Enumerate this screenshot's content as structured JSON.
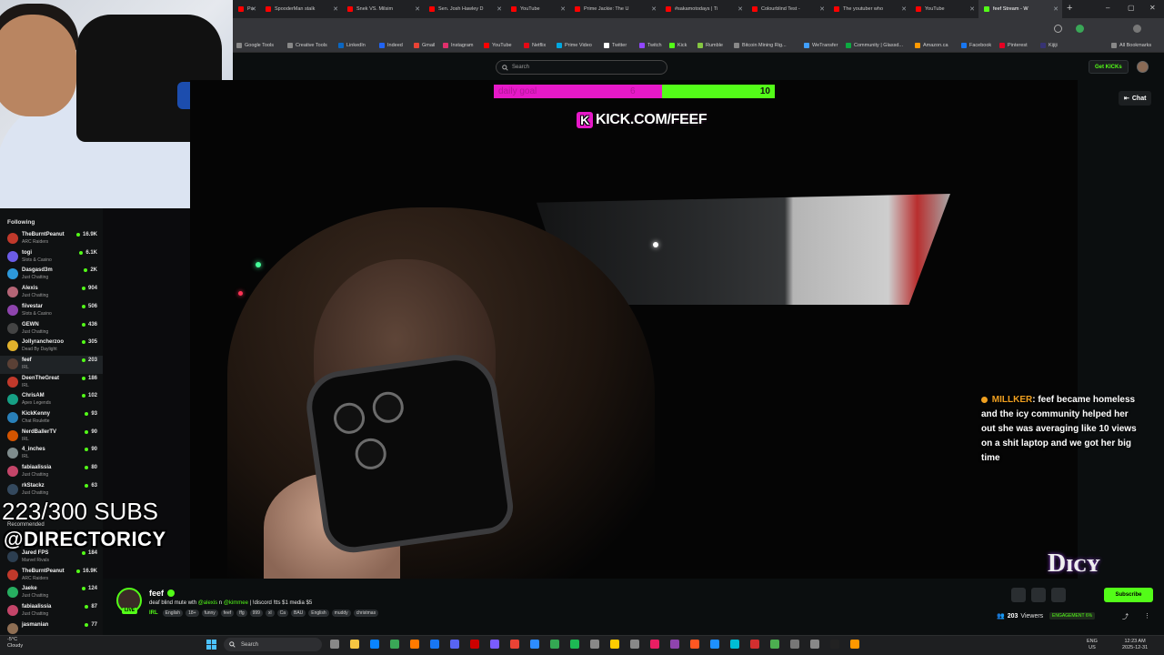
{
  "browser": {
    "tabs": [
      {
        "label": "Pa",
        "active": false
      },
      {
        "label": "SpooderMan stalk",
        "active": false
      },
      {
        "label": "Snek VS. Milsim",
        "active": false
      },
      {
        "label": "Sen. Josh Hawley D",
        "active": false
      },
      {
        "label": "YouTube",
        "active": false
      },
      {
        "label": "Prime Jackie: The U",
        "active": false
      },
      {
        "label": "#sakamotodays | Ti",
        "active": false
      },
      {
        "label": "Colourblind Test -",
        "active": false
      },
      {
        "label": "The youtuber who",
        "active": false
      },
      {
        "label": "YouTube",
        "active": false
      },
      {
        "label": "feef Stream - W",
        "active": true
      }
    ],
    "bookmarks": [
      "Google Tools",
      "Creative Tools",
      "LinkedIn",
      "Indeed",
      "Gmail",
      "Instagram",
      "YouTube",
      "Netflix",
      "Prime Video",
      "Twitter",
      "Twitch",
      "Kick",
      "Rumble",
      "Bitcoin Mining Rig...",
      "WeTransfer",
      "Community | Glassd...",
      "Amazon.ca",
      "Facebook",
      "Pinterest",
      "Kijiji"
    ],
    "all_bookmarks": "All Bookmarks"
  },
  "kick": {
    "search_placeholder": "Search",
    "get_kicks": "Get KICKs",
    "chat_label": "Chat",
    "following_label": "Following",
    "recommended_label": "Recommended",
    "following": [
      {
        "name": "TheBurntPeanut",
        "category": "ARC Raiders",
        "viewers": "16.9K",
        "color": "#c0392b"
      },
      {
        "name": "togi",
        "category": "Slots & Casino",
        "viewers": "6.1K",
        "color": "#6c5ce7"
      },
      {
        "name": "Dasgasd3m",
        "category": "Just Chatting",
        "viewers": "2K",
        "color": "#2d98da"
      },
      {
        "name": "Alexis",
        "category": "Just Chatting",
        "viewers": "904",
        "color": "#b56576"
      },
      {
        "name": "fiivestar",
        "category": "Slots & Casino",
        "viewers": "506",
        "color": "#8e44ad"
      },
      {
        "name": "GEWN",
        "category": "Just Chatting",
        "viewers": "436",
        "color": "#444"
      },
      {
        "name": "Jollyrancherzoo",
        "category": "Dead By Daylight",
        "viewers": "305",
        "color": "#e1b12c"
      },
      {
        "name": "feef",
        "category": "IRL",
        "viewers": "203",
        "color": "#5a4035"
      },
      {
        "name": "DeenTheGreat",
        "category": "IRL",
        "viewers": "186",
        "color": "#c0392b"
      },
      {
        "name": "ChrisAM",
        "category": "Apex Legends",
        "viewers": "102",
        "color": "#16a085"
      },
      {
        "name": "KickKenny",
        "category": "Chat Roulette",
        "viewers": "93",
        "color": "#2980b9"
      },
      {
        "name": "NerdBallerTV",
        "category": "IRL",
        "viewers": "90",
        "color": "#d35400"
      },
      {
        "name": "4_inches",
        "category": "IRL",
        "viewers": "90",
        "color": "#7f8c8d"
      },
      {
        "name": "fabiaalissia",
        "category": "Just Chatting",
        "viewers": "80",
        "color": "#c44569"
      },
      {
        "name": "rkStackz",
        "category": "Just Chatting",
        "viewers": "63",
        "color": "#34495e"
      }
    ],
    "recommended": [
      {
        "name": "Jared FPS",
        "category": "Marvel Rivals",
        "viewers": "184",
        "color": "#2c3e50"
      },
      {
        "name": "TheBurntPeanut",
        "category": "ARC Raiders",
        "viewers": "16.9K",
        "color": "#c0392b"
      },
      {
        "name": "Jaeke",
        "category": "Just Chatting",
        "viewers": "124",
        "color": "#27ae60"
      },
      {
        "name": "fabiaalissia",
        "category": "Just Chatting",
        "viewers": "87",
        "color": "#c44569"
      },
      {
        "name": "jasmanian",
        "category": "",
        "viewers": "77",
        "color": "#8e6e53"
      }
    ],
    "selected_index": 7
  },
  "stream_overlay": {
    "goal_label": "daily goal",
    "goal_current": "6",
    "goal_max": "10",
    "goal_progress": 0.6,
    "kick_url": "KICK.COM/FEEF",
    "chat_user": "MILLKER",
    "chat_message": ": feef became homeless and the icy community helped her out she was averaging like 10 views on a shit laptop and we got her big time",
    "subs": "223/300 SUBS",
    "handle": "@DIRECTORICY",
    "logo_text": "Director Icy"
  },
  "stream_info": {
    "streamer": "feef",
    "live": "LIVE",
    "title_before": "deaf blind mute wth ",
    "mention1": "@alexis",
    "title_mid": " n ",
    "mention2": "@kimmee",
    "title_after": " | !discord !tts $1 media $5",
    "category": "IRL",
    "tags": [
      "English",
      "18+",
      "funny",
      "feef",
      "ffg",
      "999",
      "xl",
      "Ca",
      "BAU",
      "English",
      "muddy",
      "christmas"
    ],
    "viewers": "203",
    "viewers_label": "Viewers",
    "subscribe_label": "Subscribe",
    "engagement": "ENGAGEMENT  6%"
  },
  "taskbar": {
    "temp": "-5°C",
    "weather": "Cloudy",
    "search_placeholder": "Search",
    "lang": "ENG",
    "region": "US",
    "time": "12:23 AM",
    "date": "2025-12-31"
  },
  "colors": {
    "kick_green": "#53fc18",
    "goal_pink": "#e619c8"
  }
}
